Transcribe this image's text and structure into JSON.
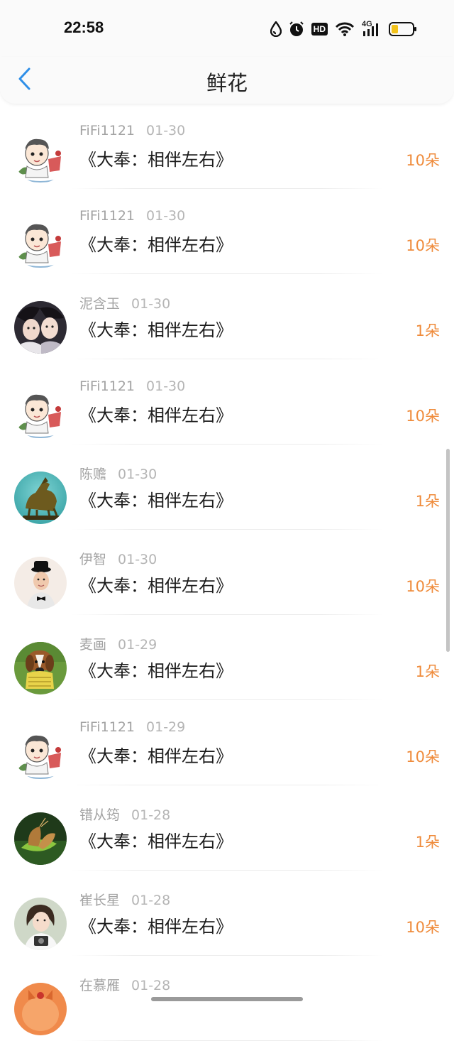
{
  "status_bar": {
    "time": "22:58",
    "icons": [
      "water-drop-icon",
      "alarm-icon",
      "hd-icon",
      "wifi-icon",
      "4g-signal-icon",
      "battery-icon"
    ],
    "hd_label": "HD",
    "network_label": "4G"
  },
  "header": {
    "title": "鲜花",
    "back_icon": "back-arrow-icon"
  },
  "colors": {
    "accent_blue": "#2f8fe8",
    "amount_orange": "#ef8b3b",
    "meta_gray": "#a3a3a3"
  },
  "items": [
    {
      "user": "FiFi1121",
      "date": "01-30",
      "book": "《大奉：相伴左右》",
      "amount": "10朵",
      "avatar": "cartoon-boy"
    },
    {
      "user": "FiFi1121",
      "date": "01-30",
      "book": "《大奉：相伴左右》",
      "amount": "10朵",
      "avatar": "cartoon-boy"
    },
    {
      "user": "泥含玉",
      "date": "01-30",
      "book": "《大奉：相伴左右》",
      "amount": "1朵",
      "avatar": "two-people-photo"
    },
    {
      "user": "FiFi1121",
      "date": "01-30",
      "book": "《大奉：相伴左右》",
      "amount": "10朵",
      "avatar": "cartoon-boy"
    },
    {
      "user": "陈赡",
      "date": "01-30",
      "book": "《大奉：相伴左右》",
      "amount": "1朵",
      "avatar": "bronze-horse"
    },
    {
      "user": "伊智",
      "date": "01-30",
      "book": "《大奉：相伴左右》",
      "amount": "10朵",
      "avatar": "man-with-hat"
    },
    {
      "user": "麦画",
      "date": "01-29",
      "book": "《大奉：相伴左右》",
      "amount": "1朵",
      "avatar": "beagle-dog"
    },
    {
      "user": "FiFi1121",
      "date": "01-29",
      "book": "《大奉：相伴左右》",
      "amount": "10朵",
      "avatar": "cartoon-boy"
    },
    {
      "user": "错从筠",
      "date": "01-28",
      "book": "《大奉：相伴左右》",
      "amount": "1朵",
      "avatar": "butterfly"
    },
    {
      "user": "崔长星",
      "date": "01-28",
      "book": "《大奉：相伴左右》",
      "amount": "10朵",
      "avatar": "girl-with-camera"
    },
    {
      "user": "在慕雁",
      "date": "01-28",
      "book": "",
      "amount": "",
      "avatar": "orange-cartoon"
    }
  ]
}
